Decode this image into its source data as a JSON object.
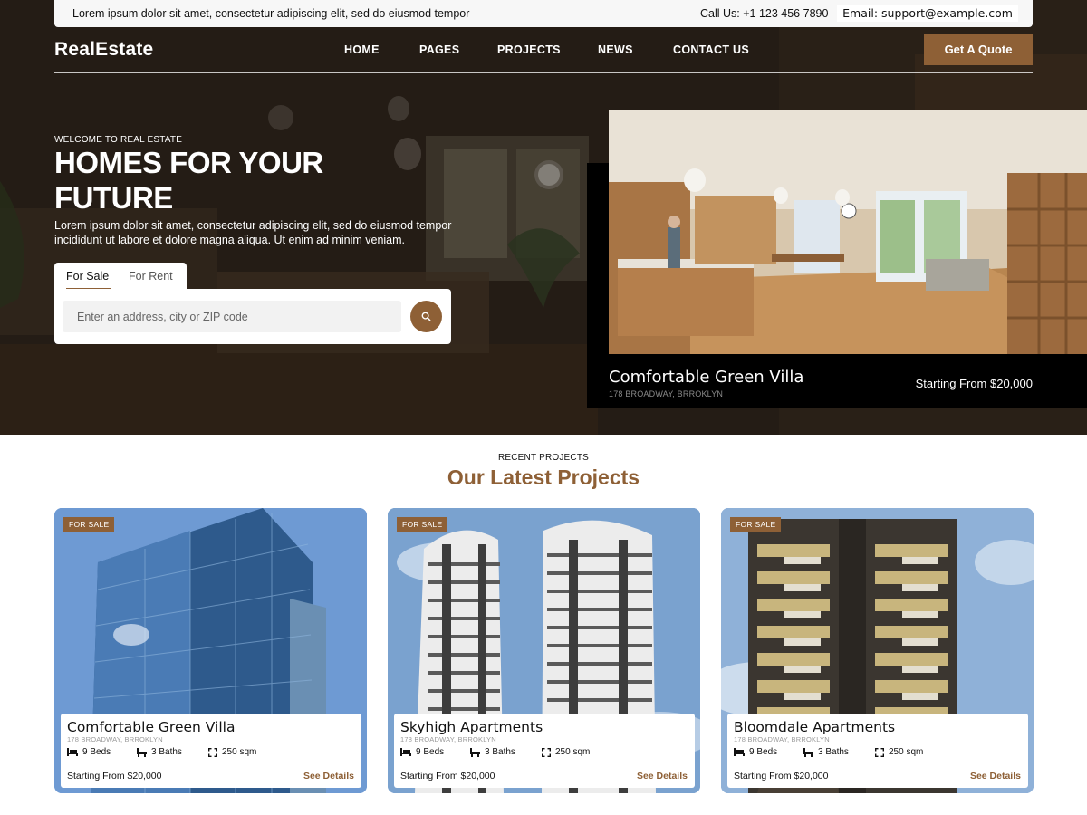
{
  "topbar": {
    "tagline": "Lorem ipsum dolor sit amet, consectetur adipiscing elit, sed do eiusmod tempor",
    "phone": "Call Us: +1 123 456 7890",
    "email": "Email: support@example.com"
  },
  "nav": {
    "logo": "RealEstate",
    "items": [
      {
        "label": "HOME"
      },
      {
        "label": "PAGES"
      },
      {
        "label": "PROJECTS"
      },
      {
        "label": "NEWS"
      },
      {
        "label": "CONTACT US"
      }
    ],
    "cta": "Get A Quote"
  },
  "hero": {
    "eyebrow": "WELCOME TO REAL ESTATE",
    "title": "HOMES FOR YOUR FUTURE",
    "description": "Lorem ipsum dolor sit amet, consectetur adipiscing elit, sed do eiusmod tempor incididunt ut labore et dolore magna aliqua. Ut enim ad minim veniam.",
    "tabs": [
      {
        "label": "For Sale"
      },
      {
        "label": "For Rent"
      }
    ],
    "search_placeholder": "Enter an address, city or ZIP code",
    "search_icon": "search-icon"
  },
  "featured": {
    "title": "Comfortable Green Villa",
    "address": "178 BROADWAY, BRROKLYN",
    "price": "Starting From $20,000"
  },
  "projects": {
    "eyebrow": "RECENT PROJECTS",
    "title": "Our Latest Projects",
    "cards": [
      {
        "badge": "FOR SALE",
        "title": "Comfortable Green Villa",
        "address": "178 BROADWAY, BRROKLYN",
        "beds": "9 Beds",
        "baths": "3 Baths",
        "area": "250 sqm",
        "price": "Starting From $20,000",
        "link": "See Details"
      },
      {
        "badge": "FOR SALE",
        "title": "Skyhigh Apartments",
        "address": "178 BROADWAY, BRROKLYN",
        "beds": "9 Beds",
        "baths": "3 Baths",
        "area": "250 sqm",
        "price": "Starting From $20,000",
        "link": "See Details"
      },
      {
        "badge": "FOR SALE",
        "title": "Bloomdale Apartments",
        "address": "178 BROADWAY, BRROKLYN",
        "beds": "9 Beds",
        "baths": "3 Baths",
        "area": "250 sqm",
        "price": "Starting From $20,000",
        "link": "See Details"
      }
    ]
  },
  "colors": {
    "accent": "#8e6036",
    "dark": "#000000",
    "light": "#ffffff"
  },
  "icons": {
    "beds": "bed-icon",
    "baths": "bath-icon",
    "area": "area-icon"
  }
}
